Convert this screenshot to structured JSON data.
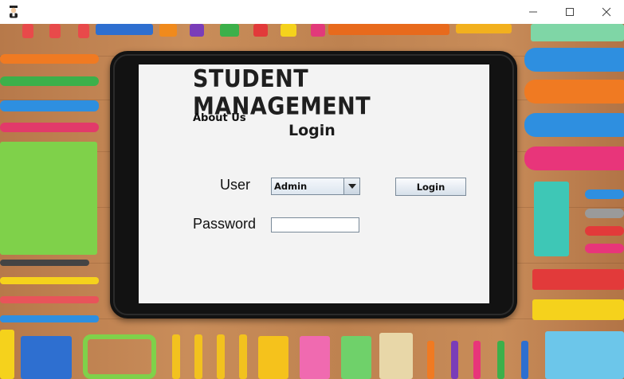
{
  "window": {
    "icon": "student-avatar-icon",
    "controls": {
      "minimize": "minimize-icon",
      "maximize": "maximize-icon",
      "close": "close-icon"
    }
  },
  "background": {
    "description_icon": "stationery-desk-photo"
  },
  "screen": {
    "heading": "Student Management",
    "about_link": "About Us",
    "form_title": "Login",
    "user_label": "User",
    "user_select_value": "Admin",
    "password_label": "Password",
    "password_value": "",
    "login_button": "Login"
  },
  "colors": {
    "screen_bg": "#f3f3f3",
    "tablet_bezel": "#121212",
    "desk": "#c98d5a"
  }
}
